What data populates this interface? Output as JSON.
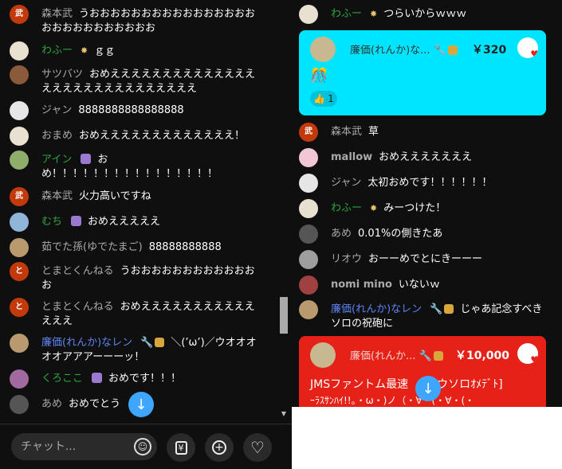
{
  "left": {
    "messages": [
      {
        "author": "森本武",
        "avatar": "武",
        "text": "うおおおおおおおおおおおおおおおおおおおおおおおおおおお"
      },
      {
        "author": "わふー",
        "badge": "✸",
        "text": "ｇｇ"
      },
      {
        "author": "サツバツ",
        "text": "おめえええええええええええええええええええええええええええええ"
      },
      {
        "author": "ジャン",
        "text": "8888888888888888"
      },
      {
        "author": "おまめ",
        "text": "おめえええええええええええええ！"
      },
      {
        "author": "アイン",
        "text": "おめ！！！！！！！！！！！！！！！！"
      },
      {
        "author": "森本武",
        "avatar": "武",
        "text": "火力高いですね"
      },
      {
        "author": "むち",
        "text": "おめえええええ"
      },
      {
        "author": "茹でた孫(ゆでたまご)",
        "text": "88888888888"
      },
      {
        "author": "とまとくんねる",
        "avatar": "と",
        "text": "うおおおおおおおおおおおおお"
      },
      {
        "author": "とまとくんねる",
        "avatar": "と",
        "text": "おめええええええええええええええ"
      },
      {
        "author": "廉価(れんか)なレン",
        "text": "＼(’ω’)／ウオオオオオアアアーーーッ！"
      },
      {
        "author": "くろここ",
        "text": "おめです！！！"
      },
      {
        "author": "あめ",
        "text": "おめでとう"
      }
    ],
    "input_placeholder": "チャット...",
    "yen_icon": "¥"
  },
  "right": {
    "top_message": {
      "author": "わふー",
      "badge": "✸",
      "text": "つらいからｗｗｗ"
    },
    "superchat1": {
      "author": "廉価(れんか)な...",
      "amount": "￥320",
      "body": "🎊",
      "likes": "1"
    },
    "messages": [
      {
        "author": "森本武",
        "avatar": "武",
        "text": "草"
      },
      {
        "author": "mallow",
        "text": "おめえええええええ"
      },
      {
        "author": "ジャン",
        "text": "太初おめです！！！！！！"
      },
      {
        "author": "わふー",
        "badge": "✸",
        "text": "みーつけた！"
      },
      {
        "author": "あめ",
        "text": "0.01%の側きたあ"
      },
      {
        "author": "リオウ",
        "text": "おーーめでとにきーーー"
      },
      {
        "author": "nomi mino",
        "text": "いないｗ"
      },
      {
        "author": "廉価(れんか)なレン",
        "text": "じゃあ記念すべきソロの祝砲に"
      }
    ],
    "superchat2": {
      "author": "廉価(れんか...",
      "amount": "￥10,000",
      "body_line1": "JMSファントム最速",
      "body_line1b": "スウソロｵﾒﾃﾞﾄ]",
      "body_line2": "ｰﾗｽｻﾝﾊｲ!!。・ω・)ノ（・∀・(・∀・(・"
    }
  },
  "colors": {
    "background": "#0f0f0f",
    "member_name": "#2ba640",
    "moderator_name": "#5e84f1",
    "superchat_cyan": "#00e5ff",
    "superchat_red": "#e62117",
    "jump_button": "#3ea6ff"
  }
}
